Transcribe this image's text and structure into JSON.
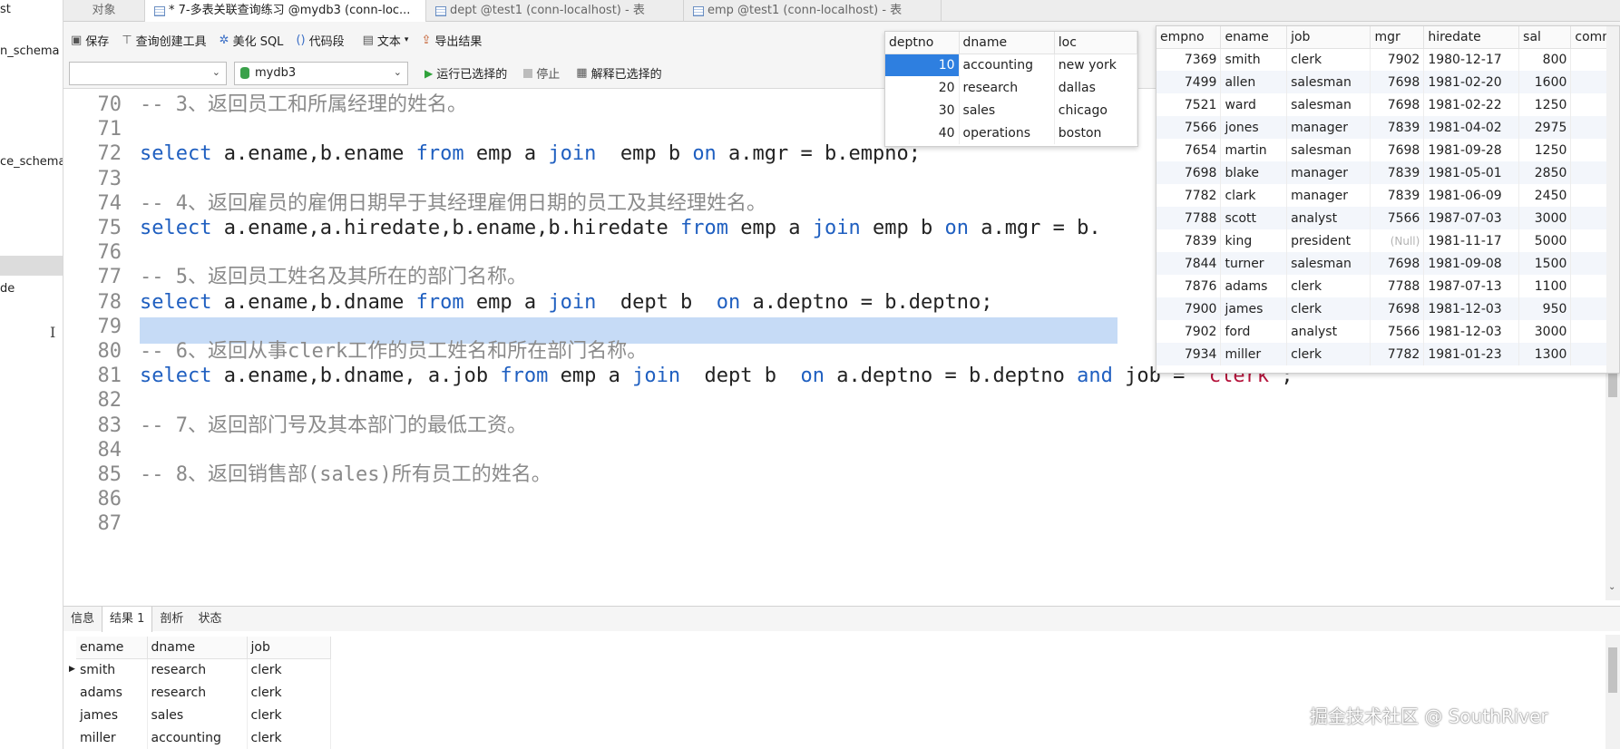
{
  "left_tree": {
    "items": [
      "st",
      "n_schema",
      "ce_schema",
      "de"
    ]
  },
  "tabs": [
    {
      "label": "对象"
    },
    {
      "label": "* 7-多表关联查询练习 @mydb3 (conn-loc..."
    },
    {
      "label": "dept @test1 (conn-localhost) - 表"
    },
    {
      "label": "emp @test1 (conn-localhost) - 表"
    }
  ],
  "toolbar": {
    "save": "保存",
    "query_builder": "查询创建工具",
    "beautify": "美化 SQL",
    "snippet": "代码段",
    "text": "文本",
    "export": "导出结果"
  },
  "runbar": {
    "connection_value": "",
    "database_value": "mydb3",
    "run_selected": "运行已选择的",
    "stop": "停止",
    "explain_selected": "解释已选择的"
  },
  "editor": {
    "lines": [
      {
        "n": "70",
        "parts": [
          {
            "t": "-- 3、返回员工和所属经理的姓名。",
            "c": "cm"
          }
        ]
      },
      {
        "n": "71",
        "parts": []
      },
      {
        "n": "72",
        "parts": [
          {
            "t": "select",
            "c": "kw"
          },
          {
            "t": " a.ename,b.ename ",
            "c": ""
          },
          {
            "t": "from",
            "c": "kw"
          },
          {
            "t": " emp a ",
            "c": ""
          },
          {
            "t": "join",
            "c": "kw"
          },
          {
            "t": "  emp b ",
            "c": ""
          },
          {
            "t": "on",
            "c": "kw"
          },
          {
            "t": " a.mgr = b.empno;",
            "c": ""
          }
        ]
      },
      {
        "n": "73",
        "parts": []
      },
      {
        "n": "74",
        "parts": [
          {
            "t": "-- 4、返回雇员的雇佣日期早于其经理雇佣日期的员工及其经理姓名。",
            "c": "cm"
          }
        ]
      },
      {
        "n": "75",
        "parts": [
          {
            "t": "select",
            "c": "kw"
          },
          {
            "t": " a.ename,a.hiredate,b.ename,b.hiredate ",
            "c": ""
          },
          {
            "t": "from",
            "c": "kw"
          },
          {
            "t": " emp a ",
            "c": ""
          },
          {
            "t": "join",
            "c": "kw"
          },
          {
            "t": " emp b ",
            "c": ""
          },
          {
            "t": "on",
            "c": "kw"
          },
          {
            "t": " a.mgr = b.",
            "c": ""
          }
        ]
      },
      {
        "n": "76",
        "parts": []
      },
      {
        "n": "77",
        "parts": [
          {
            "t": "-- 5、返回员工姓名及其所在的部门名称。",
            "c": "cm"
          }
        ]
      },
      {
        "n": "78",
        "parts": [
          {
            "t": "select",
            "c": "kw"
          },
          {
            "t": " a.ename,b.dname ",
            "c": ""
          },
          {
            "t": "from",
            "c": "kw"
          },
          {
            "t": " emp a ",
            "c": ""
          },
          {
            "t": "join",
            "c": "kw"
          },
          {
            "t": "  dept b  ",
            "c": ""
          },
          {
            "t": "on",
            "c": "kw"
          },
          {
            "t": " a.deptno = b.deptno;",
            "c": ""
          }
        ]
      },
      {
        "n": "79",
        "parts": []
      },
      {
        "n": "80",
        "parts": [
          {
            "t": "-- 6、返回从事clerk工作的员工姓名和所在部门名称。",
            "c": "cm"
          }
        ]
      },
      {
        "n": "81",
        "parts": [
          {
            "t": "select",
            "c": "kw"
          },
          {
            "t": " a.ename,b.dname, a.job ",
            "c": ""
          },
          {
            "t": "from",
            "c": "kw"
          },
          {
            "t": " emp a ",
            "c": ""
          },
          {
            "t": "join",
            "c": "kw"
          },
          {
            "t": "  dept b  ",
            "c": ""
          },
          {
            "t": "on",
            "c": "kw"
          },
          {
            "t": " a.deptno = b.deptno ",
            "c": ""
          },
          {
            "t": "and",
            "c": "kw"
          },
          {
            "t": " job = ",
            "c": ""
          },
          {
            "t": "'clerk'",
            "c": "st"
          },
          {
            "t": ";",
            "c": ""
          }
        ]
      },
      {
        "n": "82",
        "parts": []
      },
      {
        "n": "83",
        "parts": [
          {
            "t": "-- 7、返回部门号及其本部门的最低工资。",
            "c": "cm"
          }
        ]
      },
      {
        "n": "84",
        "parts": []
      },
      {
        "n": "85",
        "parts": [
          {
            "t": "-- 8、返回销售部(sales)所有员工的姓名。",
            "c": "cm"
          }
        ]
      },
      {
        "n": "86",
        "parts": []
      },
      {
        "n": "87",
        "parts": []
      }
    ]
  },
  "dept_table": {
    "columns": [
      "deptno",
      "dname",
      "loc"
    ],
    "rows": [
      [
        "10",
        "accounting",
        "new york"
      ],
      [
        "20",
        "research",
        "dallas"
      ],
      [
        "30",
        "sales",
        "chicago"
      ],
      [
        "40",
        "operations",
        "boston"
      ]
    ]
  },
  "emp_table": {
    "columns": [
      "empno",
      "ename",
      "job",
      "mgr",
      "hiredate",
      "sal",
      "comm"
    ],
    "rows": [
      [
        "7369",
        "smith",
        "clerk",
        "7902",
        "1980-12-17",
        "800",
        ""
      ],
      [
        "7499",
        "allen",
        "salesman",
        "7698",
        "1981-02-20",
        "1600",
        ""
      ],
      [
        "7521",
        "ward",
        "salesman",
        "7698",
        "1981-02-22",
        "1250",
        ""
      ],
      [
        "7566",
        "jones",
        "manager",
        "7839",
        "1981-04-02",
        "2975",
        ""
      ],
      [
        "7654",
        "martin",
        "salesman",
        "7698",
        "1981-09-28",
        "1250",
        ""
      ],
      [
        "7698",
        "blake",
        "manager",
        "7839",
        "1981-05-01",
        "2850",
        ""
      ],
      [
        "7782",
        "clark",
        "manager",
        "7839",
        "1981-06-09",
        "2450",
        ""
      ],
      [
        "7788",
        "scott",
        "analyst",
        "7566",
        "1987-07-03",
        "3000",
        ""
      ],
      [
        "7839",
        "king",
        "president",
        "(Null)",
        "1981-11-17",
        "5000",
        ""
      ],
      [
        "7844",
        "turner",
        "salesman",
        "7698",
        "1981-09-08",
        "1500",
        ""
      ],
      [
        "7876",
        "adams",
        "clerk",
        "7788",
        "1987-07-13",
        "1100",
        ""
      ],
      [
        "7900",
        "james",
        "clerk",
        "7698",
        "1981-12-03",
        "950",
        ""
      ],
      [
        "7902",
        "ford",
        "analyst",
        "7566",
        "1981-12-03",
        "3000",
        ""
      ],
      [
        "7934",
        "miller",
        "clerk",
        "7782",
        "1981-01-23",
        "1300",
        ""
      ]
    ]
  },
  "result_tabs": [
    "信息",
    "结果 1",
    "剖析",
    "状态"
  ],
  "result_table": {
    "columns": [
      "ename",
      "dname",
      "job"
    ],
    "rows": [
      [
        "smith",
        "research",
        "clerk"
      ],
      [
        "adams",
        "research",
        "clerk"
      ],
      [
        "james",
        "sales",
        "clerk"
      ],
      [
        "miller",
        "accounting",
        "clerk"
      ]
    ]
  },
  "watermark": "掘金技术社区 @ SouthRiver"
}
